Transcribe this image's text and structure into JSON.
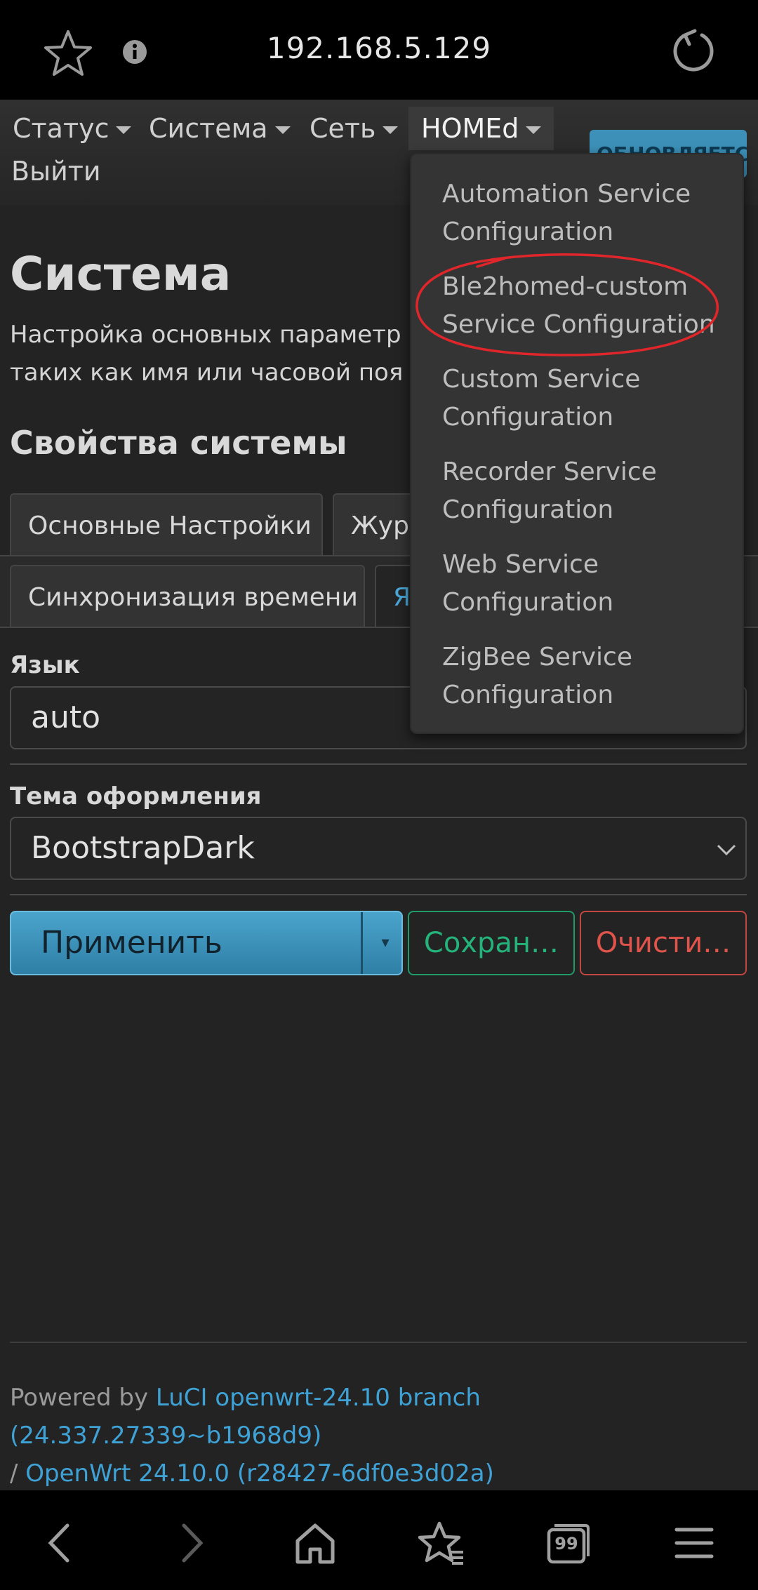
{
  "browser": {
    "url": "192.168.5.129"
  },
  "navbar": {
    "items": [
      {
        "label": "Статус"
      },
      {
        "label": "Система"
      },
      {
        "label": "Сеть"
      },
      {
        "label": "HOMEd"
      }
    ],
    "logout": "Выйти",
    "update_badge": "ОБНОВЛЯЕТСЯ"
  },
  "dropdown": {
    "items": [
      {
        "line1": "Automation Service",
        "line2": "Configuration"
      },
      {
        "line1": "Ble2homed-custom",
        "line2": "Service Configuration"
      },
      {
        "line1": "Custom Service",
        "line2": "Configuration"
      },
      {
        "line1": "Recorder Service",
        "line2": "Configuration"
      },
      {
        "line1": "Web Service",
        "line2": "Configuration"
      },
      {
        "line1": "ZigBee Service",
        "line2": "Configuration"
      }
    ]
  },
  "main": {
    "title": "Система",
    "description_line1": "Настройка основных параметр",
    "description_line2": "таких как имя или часовой поя",
    "section_title": "Свойства системы",
    "tabs_row1": [
      "Основные Настройки",
      "Журн"
    ],
    "tabs_row2": [
      "Синхронизация времени",
      "Я"
    ],
    "language_label": "Язык",
    "language_value": "auto",
    "theme_label": "Тема оформления",
    "theme_value": "BootstrapDark",
    "buttons": {
      "apply": "Применить",
      "apply_dropdown": "▾",
      "save": "Сохран…",
      "reset": "Очисти…"
    }
  },
  "footer": {
    "powered_by": "Powered by ",
    "luci_link": "LuCI openwrt-24.10 branch (24.337.27339~b1968d9)",
    "separator": " / ",
    "openwrt_link": "OpenWrt 24.10.0 (r28427-6df0e3d02a)"
  },
  "bottom_bar": {
    "tabs_count": "99"
  },
  "colors": {
    "accent": "#3d91b9",
    "save": "#24b37a",
    "reset": "#e0544b",
    "annotation": "#e0262a"
  }
}
